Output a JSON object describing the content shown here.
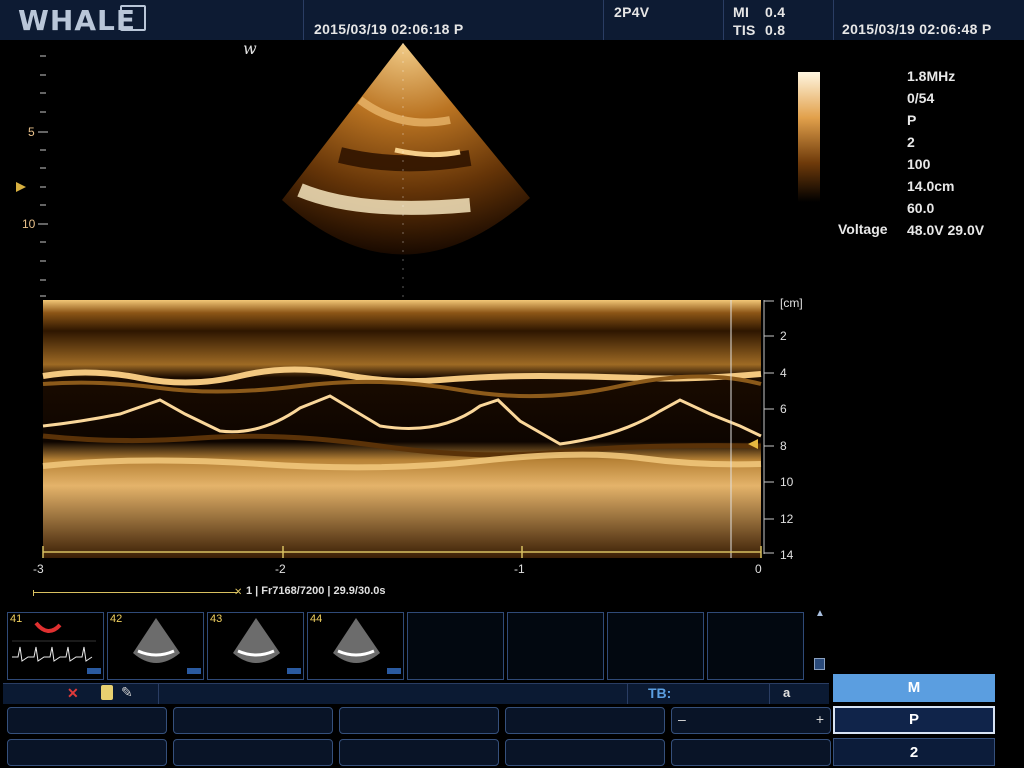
{
  "header": {
    "logo": "WHALE",
    "image_time": "2015/03/19  02:06:18 P",
    "probe": "2P4V",
    "mi_label": "MI",
    "mi_value": "0.4",
    "tis_label": "TIS",
    "tis_value": "0.8",
    "clock": "2015/03/19  02:06:48 P"
  },
  "image": {
    "marker": "w",
    "depth_ticks": [
      "5",
      "10"
    ]
  },
  "params": {
    "values": [
      "1.8MHz",
      "0/54",
      "P",
      "2",
      "100",
      "14.0cm",
      "60.0",
      "48.0V 29.0V"
    ],
    "voltage_label": "Voltage"
  },
  "mmode": {
    "depth_unit": "[cm]",
    "depth_labels": [
      "2",
      "4",
      "6",
      "8",
      "10",
      "12",
      "14"
    ],
    "time_labels": [
      "-3",
      "-2",
      "-1",
      "0"
    ]
  },
  "cine": {
    "info": "1 | Fr7168/7200 | 29.9/30.0s",
    "progress": 1.0
  },
  "thumbnails": [
    {
      "num": "41",
      "kind": "mmode-doppler"
    },
    {
      "num": "42",
      "kind": "sector"
    },
    {
      "num": "43",
      "kind": "sector"
    },
    {
      "num": "44",
      "kind": "sector"
    }
  ],
  "status": {
    "tb_label": "TB:",
    "mode_letter": "a"
  },
  "bottom_buttons": {
    "minus": "–",
    "plus": "+"
  },
  "side_panel": {
    "mode": "M",
    "probe_setting": "P",
    "value": "2"
  },
  "icons": [
    "close-icon",
    "disk-icon",
    "tool-icon",
    "scroll-up-icon",
    "scroll-down-icon"
  ],
  "colors": {
    "accent": "#5b9ee0",
    "header_bg": "#0d1b33",
    "scale_label": "#e8c08a"
  }
}
